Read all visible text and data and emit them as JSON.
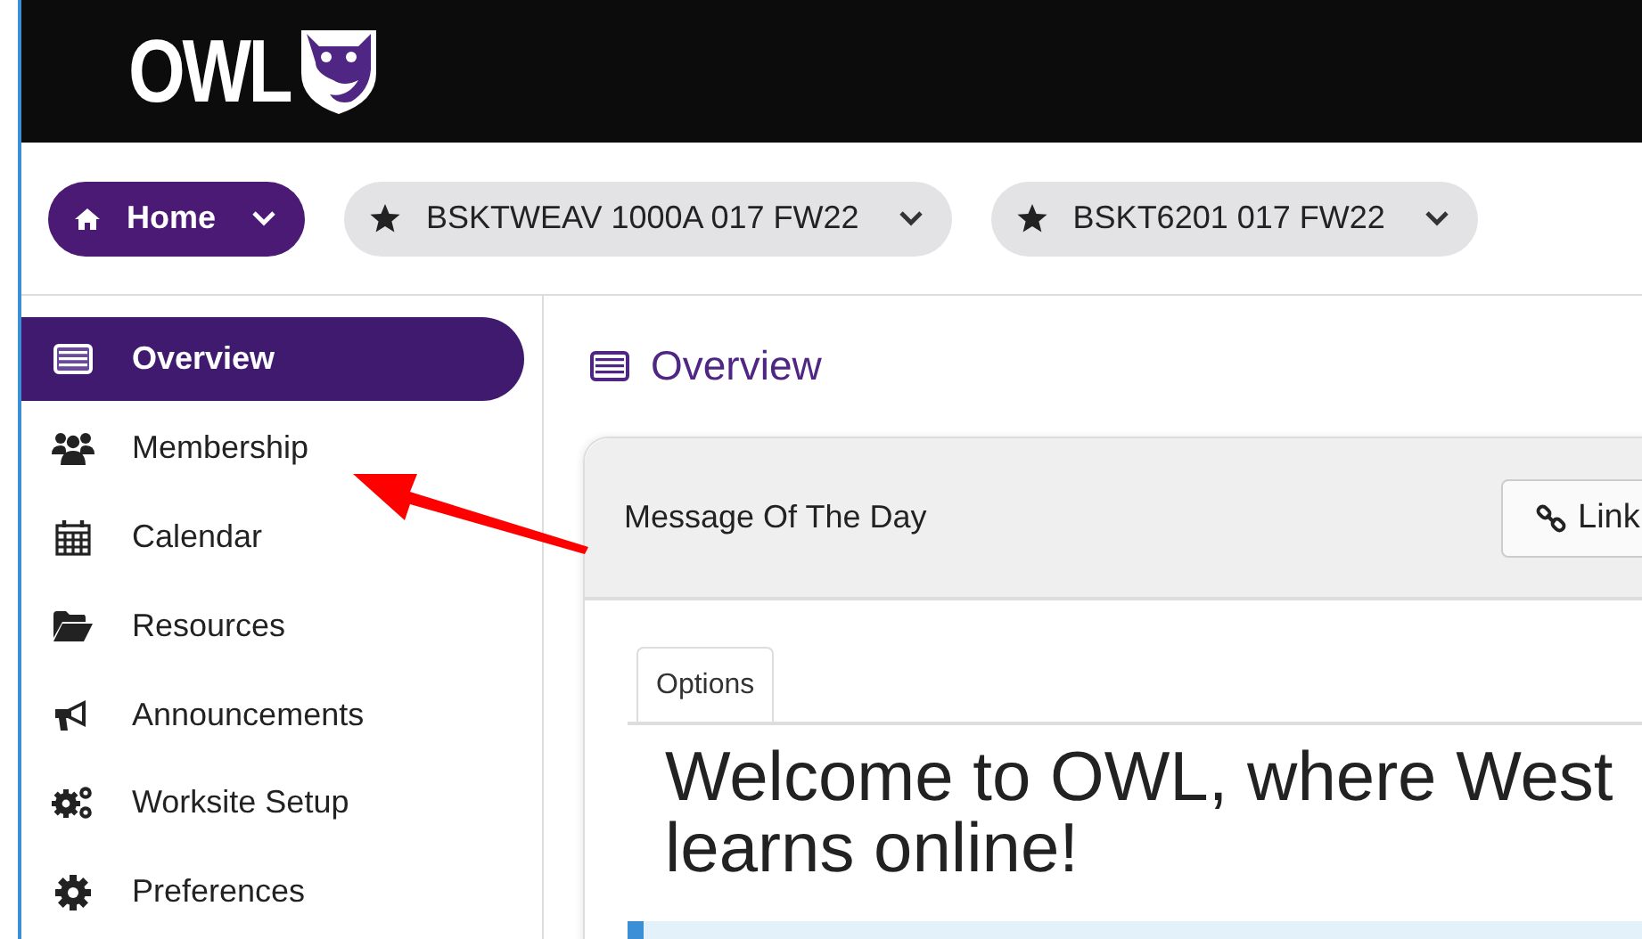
{
  "header": {
    "logo_text": "OWL"
  },
  "nav": [
    {
      "label": "Home",
      "selected": true
    },
    {
      "label": "BSKTWEAV 1000A 017 FW22",
      "selected": false
    },
    {
      "label": "BSKT6201 017 FW22",
      "selected": false
    }
  ],
  "sidebar": {
    "items": [
      {
        "label": "Overview",
        "selected": true
      },
      {
        "label": "Membership",
        "selected": false
      },
      {
        "label": "Calendar",
        "selected": false
      },
      {
        "label": "Resources",
        "selected": false
      },
      {
        "label": "Announcements",
        "selected": false
      },
      {
        "label": "Worksite Setup",
        "selected": false
      },
      {
        "label": "Preferences",
        "selected": false
      }
    ]
  },
  "main": {
    "title": "Overview",
    "card": {
      "title": "Message Of The Day",
      "button": "Link",
      "tab": "Options",
      "heading_lines": [
        "Welcome to OWL, where West",
        "learns online!"
      ]
    }
  }
}
